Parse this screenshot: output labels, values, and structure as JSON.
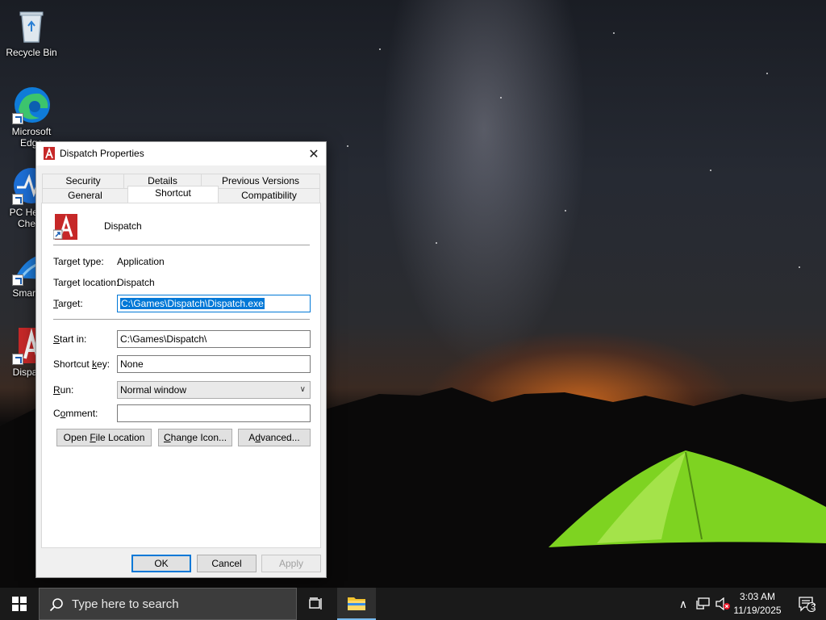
{
  "desktop": {
    "icons": [
      {
        "label": "Recycle Bin"
      },
      {
        "label": "Microsoft Edge"
      },
      {
        "label": "PC Health Check"
      },
      {
        "label": "SmartGit"
      },
      {
        "label": "Dispatch"
      }
    ]
  },
  "dialog": {
    "title": "Dispatch Properties",
    "close_symbol": "✕",
    "tabs_row1": [
      "Security",
      "Details",
      "Previous Versions"
    ],
    "tabs_row2": [
      "General",
      "Shortcut",
      "Compatibility"
    ],
    "active_tab": "Shortcut",
    "app_name": "Dispatch",
    "target_type_label": "Target type:",
    "target_type_value": "Application",
    "target_location_label": "Target location:",
    "target_location_value": "Dispatch",
    "target_label_pre": "",
    "target_label_ul": "T",
    "target_label_post": "arget:",
    "target_value": "C:\\Games\\Dispatch\\Dispatch.exe",
    "start_in_label_ul": "S",
    "start_in_label_post": "tart in:",
    "start_in_value": "C:\\Games\\Dispatch\\",
    "shortcut_key_label_pre": "Shortcut ",
    "shortcut_key_label_ul": "k",
    "shortcut_key_label_post": "ey:",
    "shortcut_key_value": "None",
    "run_label_ul": "R",
    "run_label_post": "un:",
    "run_value": "Normal window",
    "comment_label_pre": "C",
    "comment_label_ul": "o",
    "comment_label_post": "mment:",
    "comment_value": "",
    "open_file_location_pre": "Open ",
    "open_file_location_ul": "F",
    "open_file_location_post": "ile Location",
    "change_icon_pre": "",
    "change_icon_ul": "C",
    "change_icon_post": "hange Icon...",
    "advanced_pre": "A",
    "advanced_ul": "d",
    "advanced_post": "vanced...",
    "ok_label": "OK",
    "cancel_label": "Cancel",
    "apply_label": "Apply"
  },
  "taskbar": {
    "search_placeholder": "Type here to search",
    "time": "3:03 AM",
    "date": "11/19/2025",
    "notification_count": "3"
  },
  "colors": {
    "accent": "#0078d7",
    "taskbar": "#1a1a1a",
    "dialog_bg": "#f0f0f0",
    "dispatch_red": "#c62828"
  }
}
